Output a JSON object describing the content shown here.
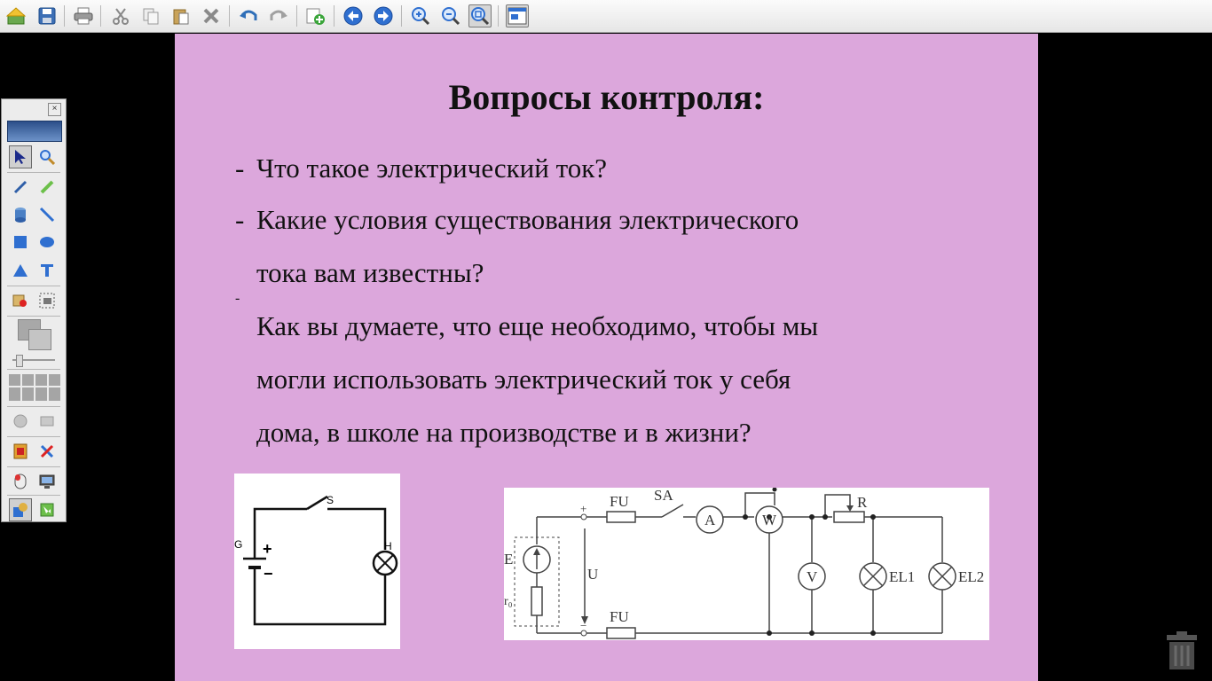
{
  "toolbar": {
    "buttons": [
      {
        "icon": "home-icon"
      },
      {
        "icon": "save-icon"
      },
      {
        "icon": "print-icon"
      },
      {
        "icon": "cut-icon"
      },
      {
        "icon": "copy-icon"
      },
      {
        "icon": "paste-icon"
      },
      {
        "icon": "delete-icon"
      },
      {
        "icon": "undo-icon"
      },
      {
        "icon": "redo-icon"
      },
      {
        "icon": "add-page-icon"
      },
      {
        "icon": "previous-page-icon"
      },
      {
        "icon": "next-page-icon"
      },
      {
        "icon": "zoom-in-icon"
      },
      {
        "icon": "zoom-out-icon"
      },
      {
        "icon": "zoom-fit-icon"
      },
      {
        "icon": "display-settings-icon"
      }
    ]
  },
  "slide": {
    "background": "#dca7dc",
    "title": "Вопросы контроля:",
    "bullet_dash": "-",
    "questions": {
      "q1": "Что такое электрический ток?",
      "q2_line1": "Какие условия существования электрического",
      "q2_line2": "тока вам известны?",
      "q3_line1": "Как вы думаете, что еще необходимо, чтобы мы",
      "q3_line2": "могли использовать электрический ток у себя",
      "q3_line3": "дома, в школе на производстве и в жизни?"
    },
    "circuit_simple": {
      "S": "S",
      "G": "G",
      "H": "H",
      "plus": "+",
      "minus": "−"
    },
    "circuit_full": {
      "FU_top": "FU",
      "FU_bottom": "FU",
      "SA": "SA",
      "A": "A",
      "W": "W",
      "R": "R",
      "V": "V",
      "EL1": "EL1",
      "EL2": "EL2",
      "E": "E",
      "r0": "r₀",
      "U": "U",
      "plus": "+",
      "minus": "−"
    }
  },
  "palette": {
    "tools": [
      "select-icon",
      "zoom-tool-icon",
      "pen-icon",
      "highlighter-icon",
      "fill-icon",
      "line-icon",
      "rectangle-icon",
      "ellipse-icon",
      "triangle-icon",
      "text-icon",
      "insert-image-icon",
      "capture-icon",
      "color-swatch",
      "thickness-slider",
      "line-style-grid",
      "eraser-icon",
      "clear-icon",
      "record-icon",
      "tools-icon",
      "mouse-icon",
      "screen-icon",
      "shapes-icon",
      "export-icon"
    ]
  },
  "trash": {
    "icon": "trash-icon"
  }
}
